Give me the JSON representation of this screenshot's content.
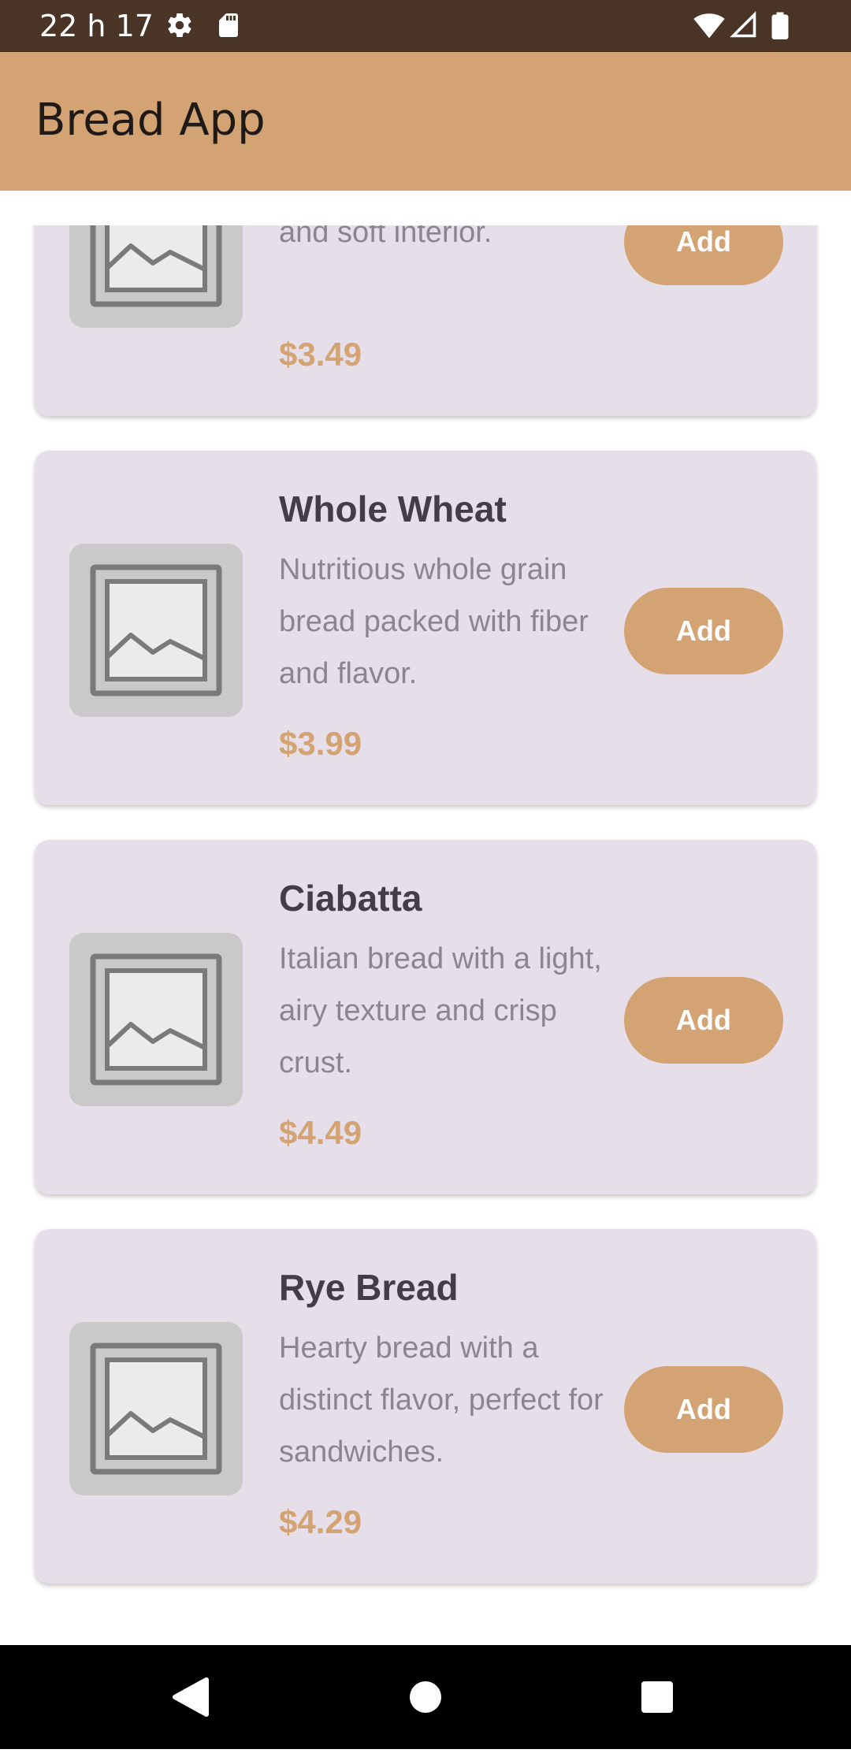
{
  "status_bar": {
    "time": "22 h 17",
    "icons": [
      "settings-icon",
      "sd-card-icon",
      "wifi-icon",
      "signal-icon",
      "battery-icon"
    ]
  },
  "app_bar": {
    "title": "Bread App"
  },
  "colors": {
    "status_bar": "#4a3426",
    "app_bar": "#d3a373",
    "card": "#e6dfe9",
    "accent": "#d3a373",
    "title_text": "#433d48",
    "desc_text": "#8a8590",
    "thumb": "#c9c9c9"
  },
  "products": [
    {
      "name": "",
      "description": "with a crispy exterior and soft interior.",
      "price": "$3.49",
      "button": "Add",
      "image": "image-placeholder-icon"
    },
    {
      "name": "Whole Wheat",
      "description": "Nutritious whole grain bread packed with fiber and flavor.",
      "price": "$3.99",
      "button": "Add",
      "image": "image-placeholder-icon"
    },
    {
      "name": "Ciabatta",
      "description": "Italian bread with a light, airy texture and crisp crust.",
      "price": "$4.49",
      "button": "Add",
      "image": "image-placeholder-icon"
    },
    {
      "name": "Rye Bread",
      "description": "Hearty bread with a distinct flavor, perfect for sandwiches.",
      "price": "$4.29",
      "button": "Add",
      "image": "image-placeholder-icon"
    }
  ],
  "nav_bar": {
    "buttons": [
      "back-icon",
      "home-icon",
      "recents-icon"
    ]
  }
}
